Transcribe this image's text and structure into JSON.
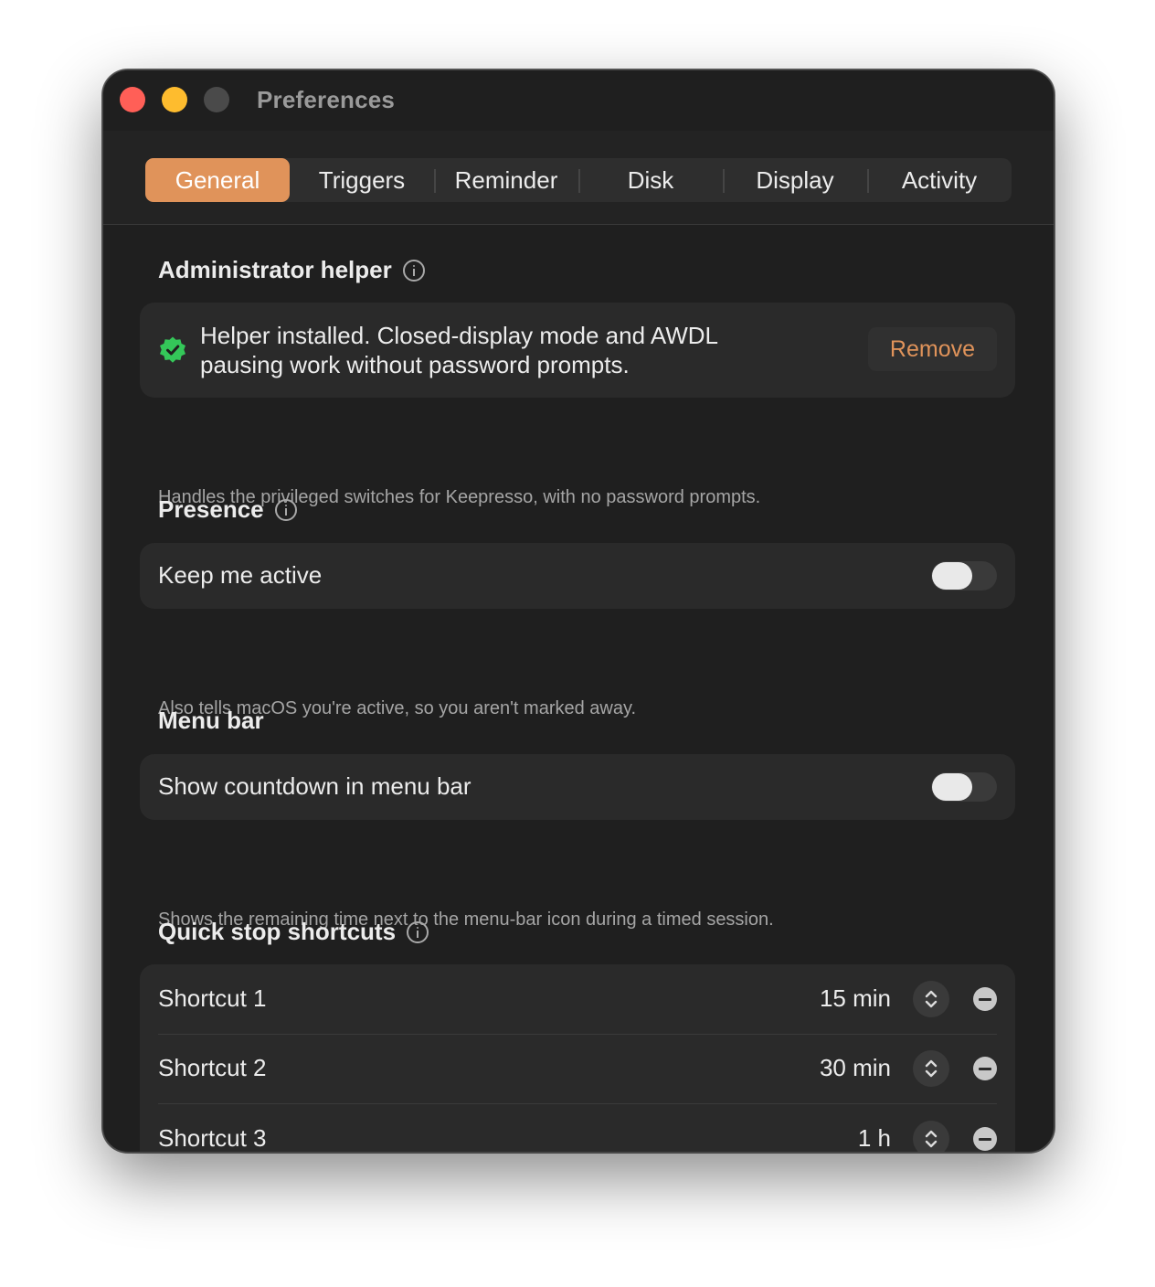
{
  "window": {
    "title": "Preferences"
  },
  "tabs": [
    {
      "label": "General",
      "active": true
    },
    {
      "label": "Triggers",
      "active": false
    },
    {
      "label": "Reminder",
      "active": false
    },
    {
      "label": "Disk",
      "active": false
    },
    {
      "label": "Display",
      "active": false
    },
    {
      "label": "Activity",
      "active": false
    }
  ],
  "admin_helper": {
    "title": "Administrator helper",
    "status_text": "Helper installed. Closed-display mode and AWDL pausing work without password prompts.",
    "remove_label": "Remove",
    "caption": "Handles the privileged switches for Keepresso, with no password prompts."
  },
  "presence": {
    "title": "Presence",
    "keep_active_label": "Keep me active",
    "keep_active_on": false,
    "caption": "Also tells macOS you're active, so you aren't marked away."
  },
  "menu_bar": {
    "title": "Menu bar",
    "countdown_label": "Show countdown in menu bar",
    "countdown_on": false,
    "caption": "Shows the remaining time next to the menu-bar icon during a timed session."
  },
  "quick_stop": {
    "title": "Quick stop shortcuts",
    "shortcuts": [
      {
        "label": "Shortcut 1",
        "value": "15 min"
      },
      {
        "label": "Shortcut 2",
        "value": "30 min"
      },
      {
        "label": "Shortcut 3",
        "value": "1 h"
      }
    ]
  },
  "colors": {
    "accent": "#e0935a",
    "success": "#34c759",
    "window_bg": "#1f1f1f",
    "card_bg": "#2a2a2a"
  }
}
